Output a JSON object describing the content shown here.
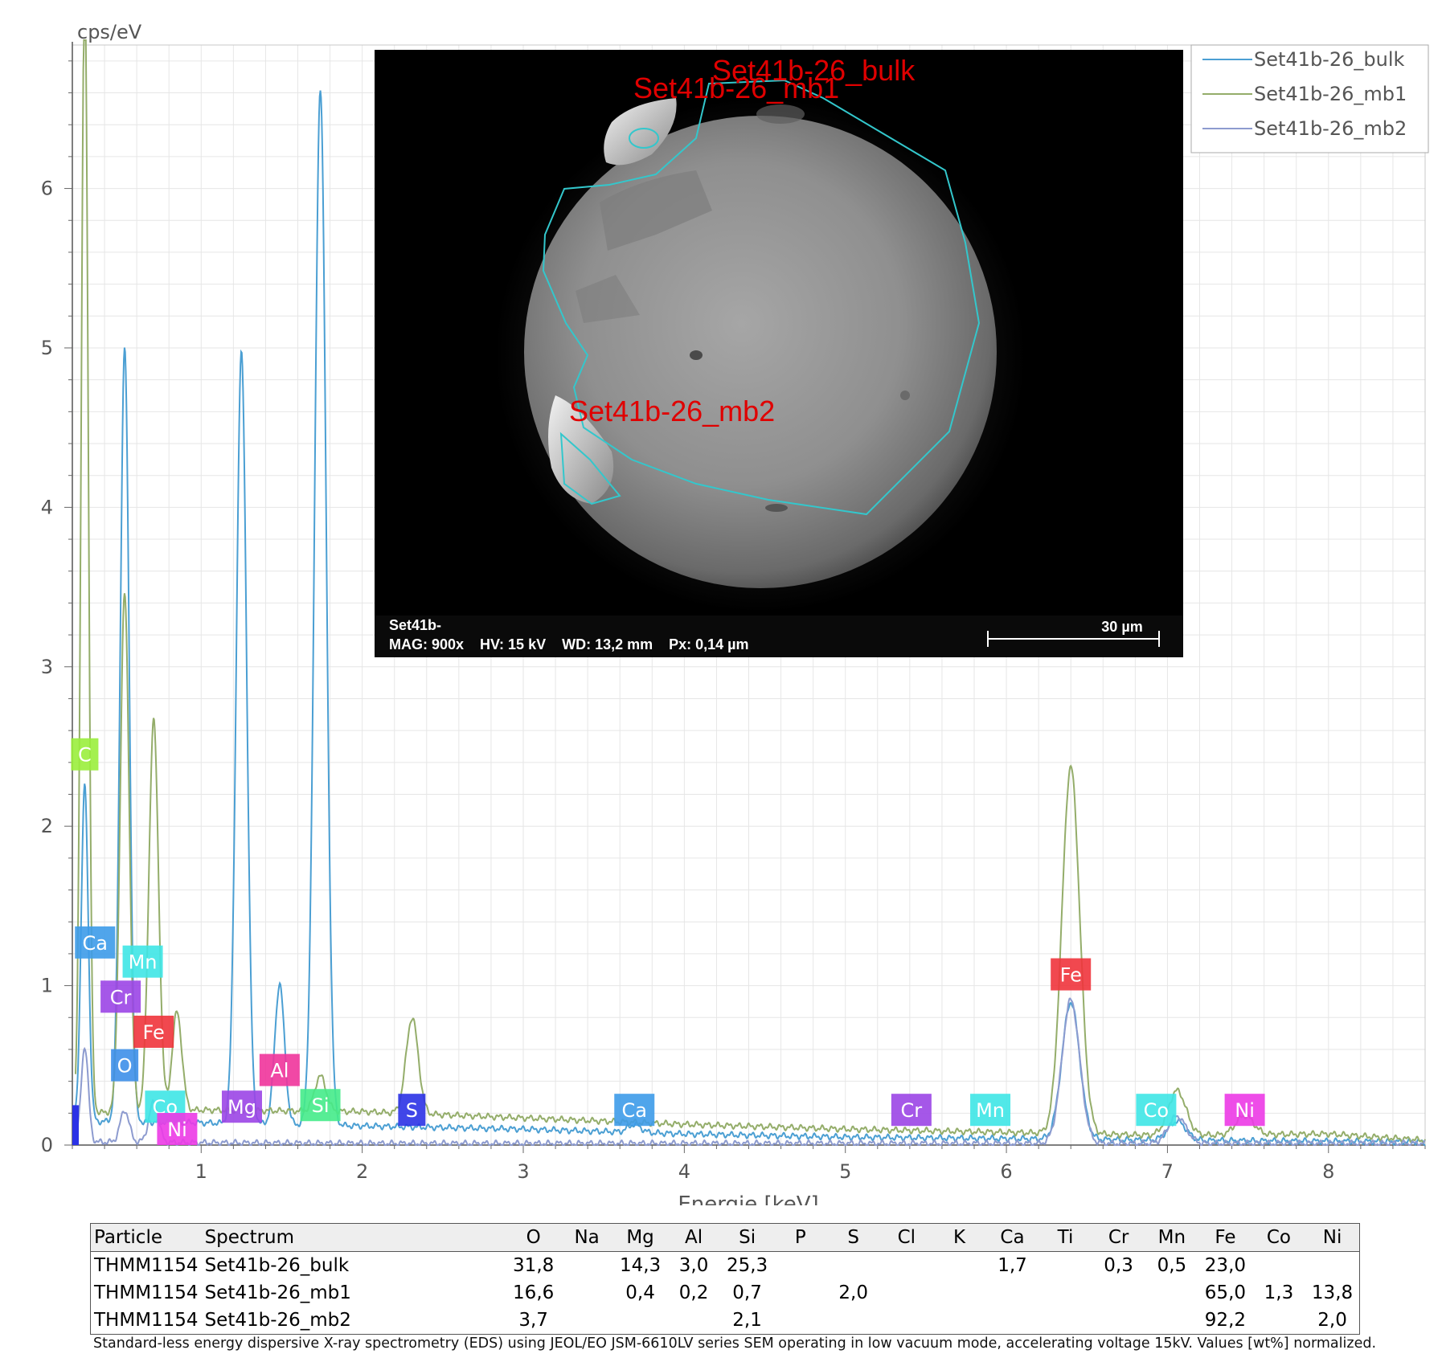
{
  "chart_data": {
    "type": "line",
    "ylabel": "cps/eV",
    "xlabel": "Energie [keV]",
    "xlim": [
      0.2,
      8.6
    ],
    "ylim": [
      0,
      6.9
    ],
    "x_ticks": [
      1,
      2,
      3,
      4,
      5,
      6,
      7,
      8
    ],
    "y_ticks": [
      0,
      1,
      2,
      3,
      4,
      5,
      6
    ],
    "grid": true,
    "legend_position": "top-right",
    "series": [
      {
        "name": "Set41b-26_bulk",
        "color": "#4b9fd3",
        "baseline": [
          [
            0.2,
            0.15
          ],
          [
            1.0,
            0.14
          ],
          [
            2.0,
            0.12
          ],
          [
            3.0,
            0.1
          ],
          [
            4.0,
            0.07
          ],
          [
            5.0,
            0.05
          ],
          [
            6.0,
            0.04
          ],
          [
            7.0,
            0.03
          ],
          [
            8.6,
            0.02
          ]
        ],
        "peaks": [
          {
            "x": 0.277,
            "y": 2.1,
            "w": 0.022
          },
          {
            "x": 0.525,
            "y": 4.85,
            "w": 0.028
          },
          {
            "x": 1.25,
            "y": 4.83,
            "w": 0.032
          },
          {
            "x": 1.487,
            "y": 0.88,
            "w": 0.03
          },
          {
            "x": 1.74,
            "y": 6.5,
            "w": 0.035
          },
          {
            "x": 3.69,
            "y": 0.05,
            "w": 0.04
          },
          {
            "x": 6.4,
            "y": 0.86,
            "w": 0.055
          },
          {
            "x": 7.06,
            "y": 0.12,
            "w": 0.055
          }
        ]
      },
      {
        "name": "Set41b-26_mb1",
        "color": "#94ad6a",
        "baseline": [
          [
            0.2,
            0.2
          ],
          [
            1.0,
            0.22
          ],
          [
            2.0,
            0.21
          ],
          [
            3.0,
            0.17
          ],
          [
            4.0,
            0.13
          ],
          [
            5.0,
            0.1
          ],
          [
            6.0,
            0.08
          ],
          [
            7.0,
            0.06
          ],
          [
            8.0,
            0.07
          ],
          [
            8.6,
            0.03
          ]
        ],
        "peaks": [
          {
            "x": 0.277,
            "y": 7.1,
            "w": 0.022
          },
          {
            "x": 0.525,
            "y": 3.25,
            "w": 0.028
          },
          {
            "x": 0.705,
            "y": 2.45,
            "w": 0.03
          },
          {
            "x": 0.85,
            "y": 0.62,
            "w": 0.03
          },
          {
            "x": 1.74,
            "y": 0.22,
            "w": 0.035
          },
          {
            "x": 2.31,
            "y": 0.6,
            "w": 0.038
          },
          {
            "x": 6.4,
            "y": 2.3,
            "w": 0.055
          },
          {
            "x": 7.06,
            "y": 0.28,
            "w": 0.055
          },
          {
            "x": 7.48,
            "y": 0.12,
            "w": 0.055
          }
        ]
      },
      {
        "name": "Set41b-26_mb2",
        "color": "#8d9bcf",
        "baseline": [
          [
            0.2,
            0.02
          ],
          [
            1.0,
            0.015
          ],
          [
            2.0,
            0.01
          ],
          [
            4.0,
            0.01
          ],
          [
            6.0,
            0.01
          ],
          [
            8.6,
            0.01
          ]
        ],
        "peaks": [
          {
            "x": 0.277,
            "y": 0.6,
            "w": 0.022
          },
          {
            "x": 0.525,
            "y": 0.2,
            "w": 0.028
          },
          {
            "x": 0.705,
            "y": 0.25,
            "w": 0.03
          },
          {
            "x": 6.4,
            "y": 0.9,
            "w": 0.055
          },
          {
            "x": 7.06,
            "y": 0.17,
            "w": 0.055
          }
        ]
      }
    ],
    "element_markers": [
      {
        "label": "C",
        "x": 0.277,
        "y": 2.35,
        "color": "#9aee3c"
      },
      {
        "label": "Ca",
        "x": 0.341,
        "y": 1.17,
        "color": "#3d9be9"
      },
      {
        "label": "Mn",
        "x": 0.637,
        "y": 1.05,
        "color": "#3ee6e6"
      },
      {
        "label": "Cr",
        "x": 0.5,
        "y": 0.83,
        "color": "#9b45e6"
      },
      {
        "label": "Fe",
        "x": 0.705,
        "y": 0.61,
        "color": "#f0343c"
      },
      {
        "label": "O",
        "x": 0.525,
        "y": 0.4,
        "color": "#3d8fe9"
      },
      {
        "label": "Co",
        "x": 0.776,
        "y": 0.14,
        "color": "#3ee6e6"
      },
      {
        "label": "Ni",
        "x": 0.851,
        "y": 0.0,
        "color": "#ec3ae5"
      },
      {
        "label": "Mg",
        "x": 1.253,
        "y": 0.14,
        "color": "#9b45e6"
      },
      {
        "label": "Al",
        "x": 1.487,
        "y": 0.37,
        "color": "#f0349b"
      },
      {
        "label": "Si",
        "x": 1.74,
        "y": 0.15,
        "color": "#45eb8a"
      },
      {
        "label": "S",
        "x": 2.308,
        "y": 0.12,
        "color": "#2b32e6"
      },
      {
        "label": "Ca",
        "x": 3.69,
        "y": 0.12,
        "color": "#3d9be9"
      },
      {
        "label": "Cr",
        "x": 5.41,
        "y": 0.12,
        "color": "#9b45e6"
      },
      {
        "label": "Mn",
        "x": 5.9,
        "y": 0.12,
        "color": "#3ee6e6"
      },
      {
        "label": "Fe",
        "x": 6.4,
        "y": 0.97,
        "color": "#f0343c"
      },
      {
        "label": "Co",
        "x": 6.93,
        "y": 0.12,
        "color": "#3ee6e6"
      },
      {
        "label": "Ni",
        "x": 7.48,
        "y": 0.12,
        "color": "#ec3ae5"
      }
    ]
  },
  "inset": {
    "region_labels": [
      "Set41b-26_bulk",
      "Set41b-26_mb1",
      "Set41b-26_mb2"
    ],
    "sample_line": "Set41b-",
    "params_line": "MAG: 900x    HV: 15 kV    WD: 13,2 mm    Px: 0,14 µm",
    "scale_label": "30 µm",
    "outline_color": "#33c7cc"
  },
  "table": {
    "headers": [
      "Particle",
      "Spectrum",
      "O",
      "Na",
      "Mg",
      "Al",
      "Si",
      "P",
      "S",
      "Cl",
      "K",
      "Ca",
      "Ti",
      "Cr",
      "Mn",
      "Fe",
      "Co",
      "Ni"
    ],
    "rows": [
      [
        "THMM1154",
        "Set41b-26_bulk",
        "31,8",
        "",
        "14,3",
        "3,0",
        "25,3",
        "",
        "",
        "",
        "",
        "1,7",
        "",
        "0,3",
        "0,5",
        "23,0",
        "",
        ""
      ],
      [
        "THMM1154",
        "Set41b-26_mb1",
        "16,6",
        "",
        "0,4",
        "0,2",
        "0,7",
        "",
        "2,0",
        "",
        "",
        "",
        "",
        "",
        "",
        "65,0",
        "1,3",
        "13,8"
      ],
      [
        "THMM1154",
        "Set41b-26_mb2",
        "3,7",
        "",
        "",
        "",
        "2,1",
        "",
        "",
        "",
        "",
        "",
        "",
        "",
        "",
        "92,2",
        "",
        "2,0"
      ]
    ]
  },
  "footnote": "Standard-less energy dispersive X-ray spectrometry (EDS) using JEOL/EO JSM-6610LV series SEM operating in low vacuum mode, accelerating voltage 15kV. Values [wt%] normalized."
}
